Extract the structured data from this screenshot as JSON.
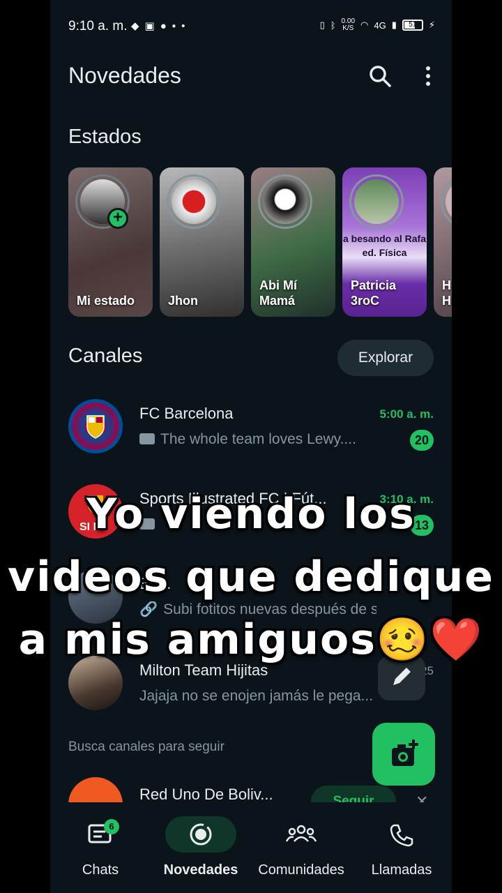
{
  "status_bar": {
    "time": "9:10 a. m.",
    "speed": "0.00",
    "speed_unit": "K/S",
    "network": "4G",
    "battery": "51"
  },
  "header": {
    "title": "Novedades"
  },
  "estados": {
    "heading": "Estados",
    "items": [
      {
        "name": "Mi estado"
      },
      {
        "name": "Jhon"
      },
      {
        "name": "Abi Mí Mamá"
      },
      {
        "name": "Patricia 3roC",
        "overlay_text": "a besando al Rafa ed. Física"
      },
      {
        "name": "H H"
      }
    ]
  },
  "canales": {
    "heading": "Canales",
    "explore_label": "Explorar",
    "items": [
      {
        "name": "FC Barcelona",
        "message": "The whole team loves Lewy....",
        "time": "5:00 a. m.",
        "unread": "20"
      },
      {
        "name": "Sports Illustrated FC | Fút...",
        "message": "",
        "time": "3:10 a. m.",
        "unread": "13"
      },
      {
        "name": "Ba...",
        "message": "Subi fotitos nuevas después de s...",
        "time": "",
        "unread": ""
      },
      {
        "name": "Milton Team Hijitas",
        "message": "Jajaja no se enojen jamás le pega...",
        "time": "19/...25",
        "unread": ""
      }
    ],
    "suggest_label": "Busca canales para seguir",
    "suggested": {
      "name": "Red Uno De Boliv...",
      "follow_label": "Seguir"
    }
  },
  "bottom_nav": {
    "items": [
      {
        "label": "Chats",
        "badge": "6"
      },
      {
        "label": "Novedades"
      },
      {
        "label": "Comunidades"
      },
      {
        "label": "Llamadas"
      }
    ]
  },
  "overlay_caption": {
    "line1": "Yo viendo los",
    "line2": "videos que dedique",
    "line3": "a mis amiguos🥴❤️"
  },
  "colors": {
    "background": "#0b141a",
    "accent": "#21c063",
    "muted": "#8696a0"
  }
}
